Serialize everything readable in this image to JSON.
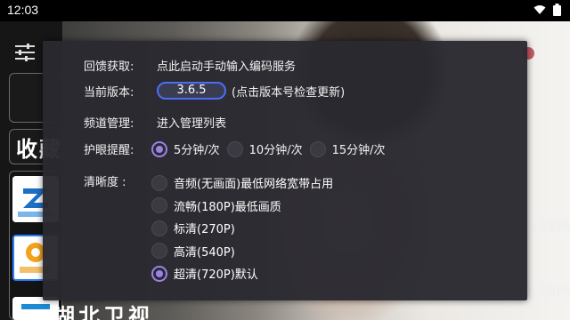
{
  "status_bar": {
    "time": "12:03"
  },
  "sidebar": {
    "favorites_label": "收藏",
    "bottom_channel_title": "湖北卫视"
  },
  "right_overlay": {
    "line1": "5:锦绣",
    "line2": "5:锦绣"
  },
  "dialog": {
    "feedback": {
      "label": "回馈获取:",
      "value": "点此启动手动输入编码服务"
    },
    "version": {
      "label": "当前版本:",
      "button": "3.6.5",
      "hint": "(点击版本号检查更新)"
    },
    "channel_mgmt": {
      "label": "频道管理:",
      "value": "进入管理列表"
    },
    "eye_care": {
      "label": "护眼提醒:",
      "options": [
        "5分钟/次",
        "10分钟/次",
        "15分钟/次"
      ],
      "selected": "5分钟/次"
    },
    "quality": {
      "label": "清晰度 :",
      "options": [
        "音频(无画面)最低网络宽带占用",
        "流畅(180P)最低画质",
        "标清(270P)",
        "高清(540P)",
        "超清(720P)默认"
      ],
      "selected": "超清(720P)默认"
    }
  },
  "colors": {
    "dialog_bg": "#2a2931",
    "accent": "#9b83e6",
    "version_border": "#4b6ef5"
  }
}
